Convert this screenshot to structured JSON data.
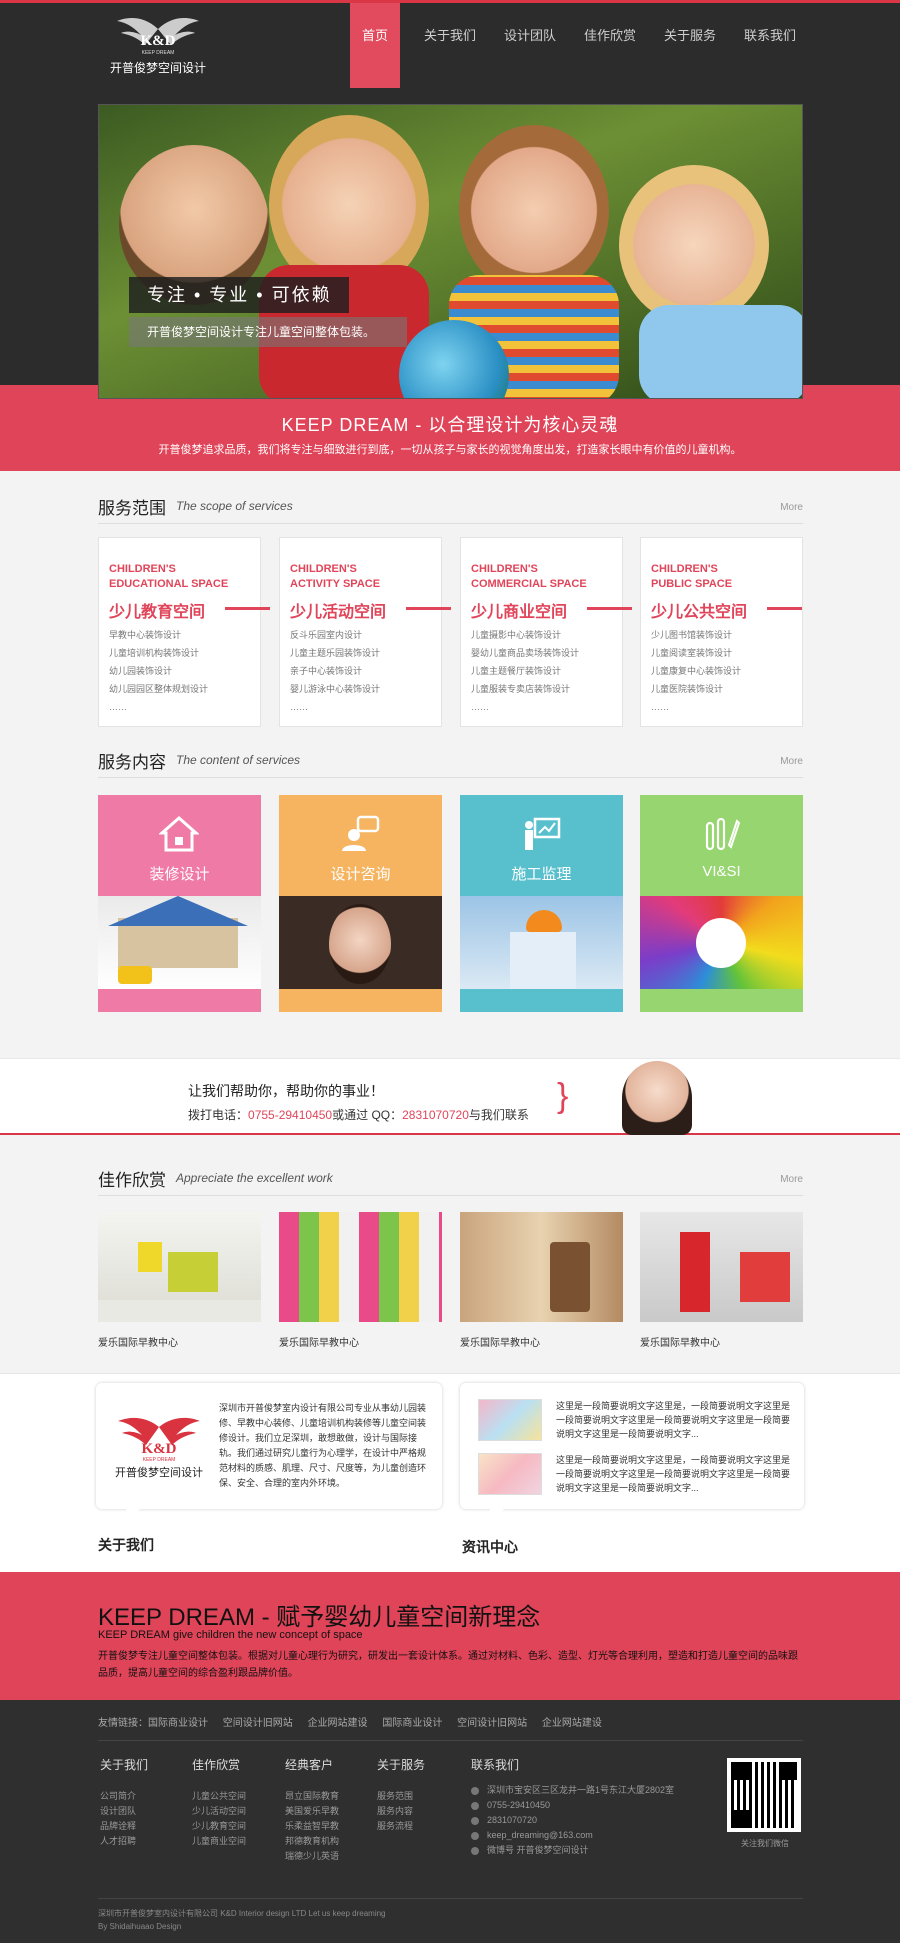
{
  "brand": {
    "logo_text": "K&D",
    "logo_sub": "KEEP DREAM",
    "name": "开普俊梦空间设计"
  },
  "nav": [
    "首页",
    "关于我们",
    "设计团队",
    "佳作欣赏",
    "关于服务",
    "联系我们"
  ],
  "hero": {
    "tag": "专注 • 专业 • 可依赖",
    "desc": "开普俊梦空间设计专注儿童空间整体包装。"
  },
  "band": {
    "title": "KEEP DREAM - 以合理设计为核心灵魂",
    "sub": "开普俊梦追求品质，我们将专注与细致进行到底，一切从孩子与家长的视觉角度出发，打造家长眼中有价值的儿童机构。"
  },
  "scope": {
    "title": "服务范围",
    "en": "The scope of services",
    "more": "More",
    "cards": [
      {
        "en1": "CHILDREN'S",
        "en2": "EDUCATIONAL SPACE",
        "cn": "少儿教育空间",
        "items": [
          "早教中心装饰设计",
          "儿童培训机构装饰设计",
          "幼儿园装饰设计",
          "幼儿园园区整体规划设计",
          "……"
        ]
      },
      {
        "en1": "CHILDREN'S",
        "en2": "ACTIVITY SPACE",
        "cn": "少儿活动空间",
        "items": [
          "反斗乐园室内设计",
          "儿童主题乐园装饰设计",
          "亲子中心装饰设计",
          "婴儿游泳中心装饰设计",
          "……"
        ]
      },
      {
        "en1": "CHILDREN'S",
        "en2": "COMMERCIAL SPACE",
        "cn": "少儿商业空间",
        "items": [
          "儿童摄影中心装饰设计",
          "婴幼儿童商品卖场装饰设计",
          "儿童主题餐厅装饰设计",
          "儿童服装专卖店装饰设计",
          "……"
        ]
      },
      {
        "en1": "CHILDREN'S",
        "en2": "PUBLIC SPACE",
        "cn": "少儿公共空间",
        "items": [
          "少儿图书馆装饰设计",
          "儿童阅读室装饰设计",
          "儿童康复中心装饰设计",
          "儿童医院装饰设计",
          "……"
        ]
      }
    ]
  },
  "content": {
    "title": "服务内容",
    "en": "The content of services",
    "more": "More",
    "tiles": [
      {
        "label": "装修设计",
        "icon": "house-icon",
        "color": "#f07aa6"
      },
      {
        "label": "设计咨询",
        "icon": "chat-person-icon",
        "color": "#f6b461"
      },
      {
        "label": "施工监理",
        "icon": "teacher-board-icon",
        "color": "#58c0cd"
      },
      {
        "label": "VI&SI",
        "icon": "pens-icon",
        "color": "#96d56f"
      }
    ]
  },
  "help": {
    "line1": "让我们帮助你，帮助你的事业！",
    "l2a": "拨打电话：",
    "phone": "0755-29410450",
    "l2b": "或通过 QQ：",
    "qq": "2831070720",
    "l2c": "与我们联系"
  },
  "works": {
    "title": "佳作欣赏",
    "en": "Appreciate the excellent work",
    "more": "More",
    "items": [
      "爱乐国际早教中心",
      "爱乐国际早教中心",
      "爱乐国际早教中心",
      "爱乐国际早教中心"
    ]
  },
  "about": {
    "label": "关于我们",
    "text": "深圳市开普俊梦室内设计有限公司专业从事幼儿园装修、早教中心装修、儿童培训机构装修等儿童空间装修设计。我们立足深圳，敢想敢做，设计与国际接轨。我们通过研究儿童行为心理学，在设计中严格规范材料的质感、肌理、尺寸、尺度等，为儿童创造环保、安全、合理的室内外环境。"
  },
  "news": {
    "label": "资讯中心",
    "items": [
      "这里是一段简要说明文字这里是，一段简要说明文字这里是一段简要说明文字这里是一段简要说明文字这里是一段简要说明文字这里是一段简要说明文字...",
      "这里是一段简要说明文字这里是，一段简要说明文字这里是一段简要说明文字这里是一段简要说明文字这里是一段简要说明文字这里是一段简要说明文字..."
    ]
  },
  "band2": {
    "title": "KEEP DREAM - 赋予婴幼儿童空间新理念",
    "sub": "KEEP DREAM give children the new concept of space",
    "para": "开普俊梦专注儿童空间整体包装。根据对儿童心理行为研究，研发出一套设计体系。通过对材料、色彩、造型、灯光等合理利用，塑造和打造儿童空间的品味跟品质，提高儿童空间的综合盈利跟品牌价值。"
  },
  "footer": {
    "links": [
      "友情链接：国际商业设计",
      "空间设计旧网站",
      "企业网站建设",
      "国际商业设计",
      "空间设计旧网站",
      "企业网站建设"
    ],
    "cols": [
      {
        "title": "关于我们",
        "items": [
          "公司简介",
          "设计团队",
          "品牌诠释",
          "人才招聘"
        ]
      },
      {
        "title": "佳作欣赏",
        "items": [
          "儿童公共空间",
          "少儿活动空间",
          "少儿教育空间",
          "儿童商业空间"
        ]
      },
      {
        "title": "经典客户",
        "items": [
          "昂立国际教育",
          "美国爱乐早教",
          "乐柔益智早教",
          "邦德教育机构",
          "瑞德少儿英语"
        ]
      },
      {
        "title": "关于服务",
        "items": [
          "服务范围",
          "服务内容",
          "服务流程"
        ]
      }
    ],
    "contact_title": "联系我们",
    "contact": [
      "深圳市宝安区三区龙井一路1号东江大厦2802室",
      "0755-29410450",
      "2831070720",
      "keep_dreaming@163.com",
      "微博号  开普俊梦空间设计"
    ],
    "qr_caption": "关注我们微信",
    "copy1": "深圳市开普俊梦室内设计有限公司 K&D Interior design LTD Let us keep dreaming",
    "copy2": "By Shidaihuaao Design"
  }
}
